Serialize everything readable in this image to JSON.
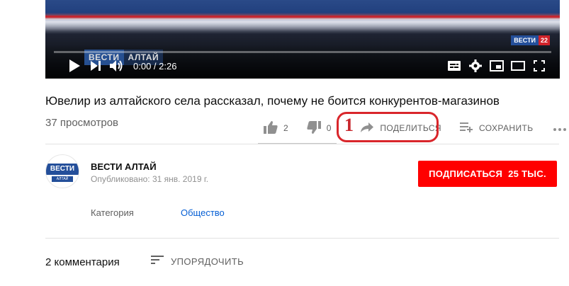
{
  "player": {
    "watermark_primary": "ВЕСТИ",
    "watermark_secondary": "АЛТАЙ",
    "bug_primary": "ВЕСТИ",
    "bug_secondary": "22",
    "progress_fraction": 0.0,
    "time_display": "0:00 / 2:26",
    "controls": [
      "play-icon",
      "next-icon",
      "volume-icon",
      "subtitles-icon",
      "gear-icon",
      "miniplayer-icon",
      "theater-icon",
      "fullscreen-icon"
    ]
  },
  "video": {
    "title": "Ювелир из алтайского села рассказал, почему не боится конкурентов-магазинов",
    "views": "37 просмотров"
  },
  "actions": {
    "like_count": "2",
    "dislike_count": "0",
    "share_label": "ПОДЕЛИТЬСЯ",
    "save_label": "СОХРАНИТЬ",
    "sentiment_fraction": 1.0
  },
  "annotation": {
    "number": "1",
    "color": "#d9262b"
  },
  "channel": {
    "avatar_text_top": "ВЕСТИ",
    "avatar_text_bottom": "АЛТАЙ",
    "name": "ВЕСТИ АЛТАЙ",
    "published": "Опубликовано: 31 янв. 2019 г.",
    "subscribe_label": "ПОДПИСАТЬСЯ",
    "subscriber_count": "25 ТЫС."
  },
  "metadata": {
    "category_label": "Категория",
    "category_value": "Общество"
  },
  "comments": {
    "count": "2 комментария",
    "sort_label": "УПОРЯДОЧИТЬ"
  },
  "colors": {
    "subscribe_bg": "#ff0000",
    "link": "#065fd4",
    "progress": "#ff0000"
  }
}
